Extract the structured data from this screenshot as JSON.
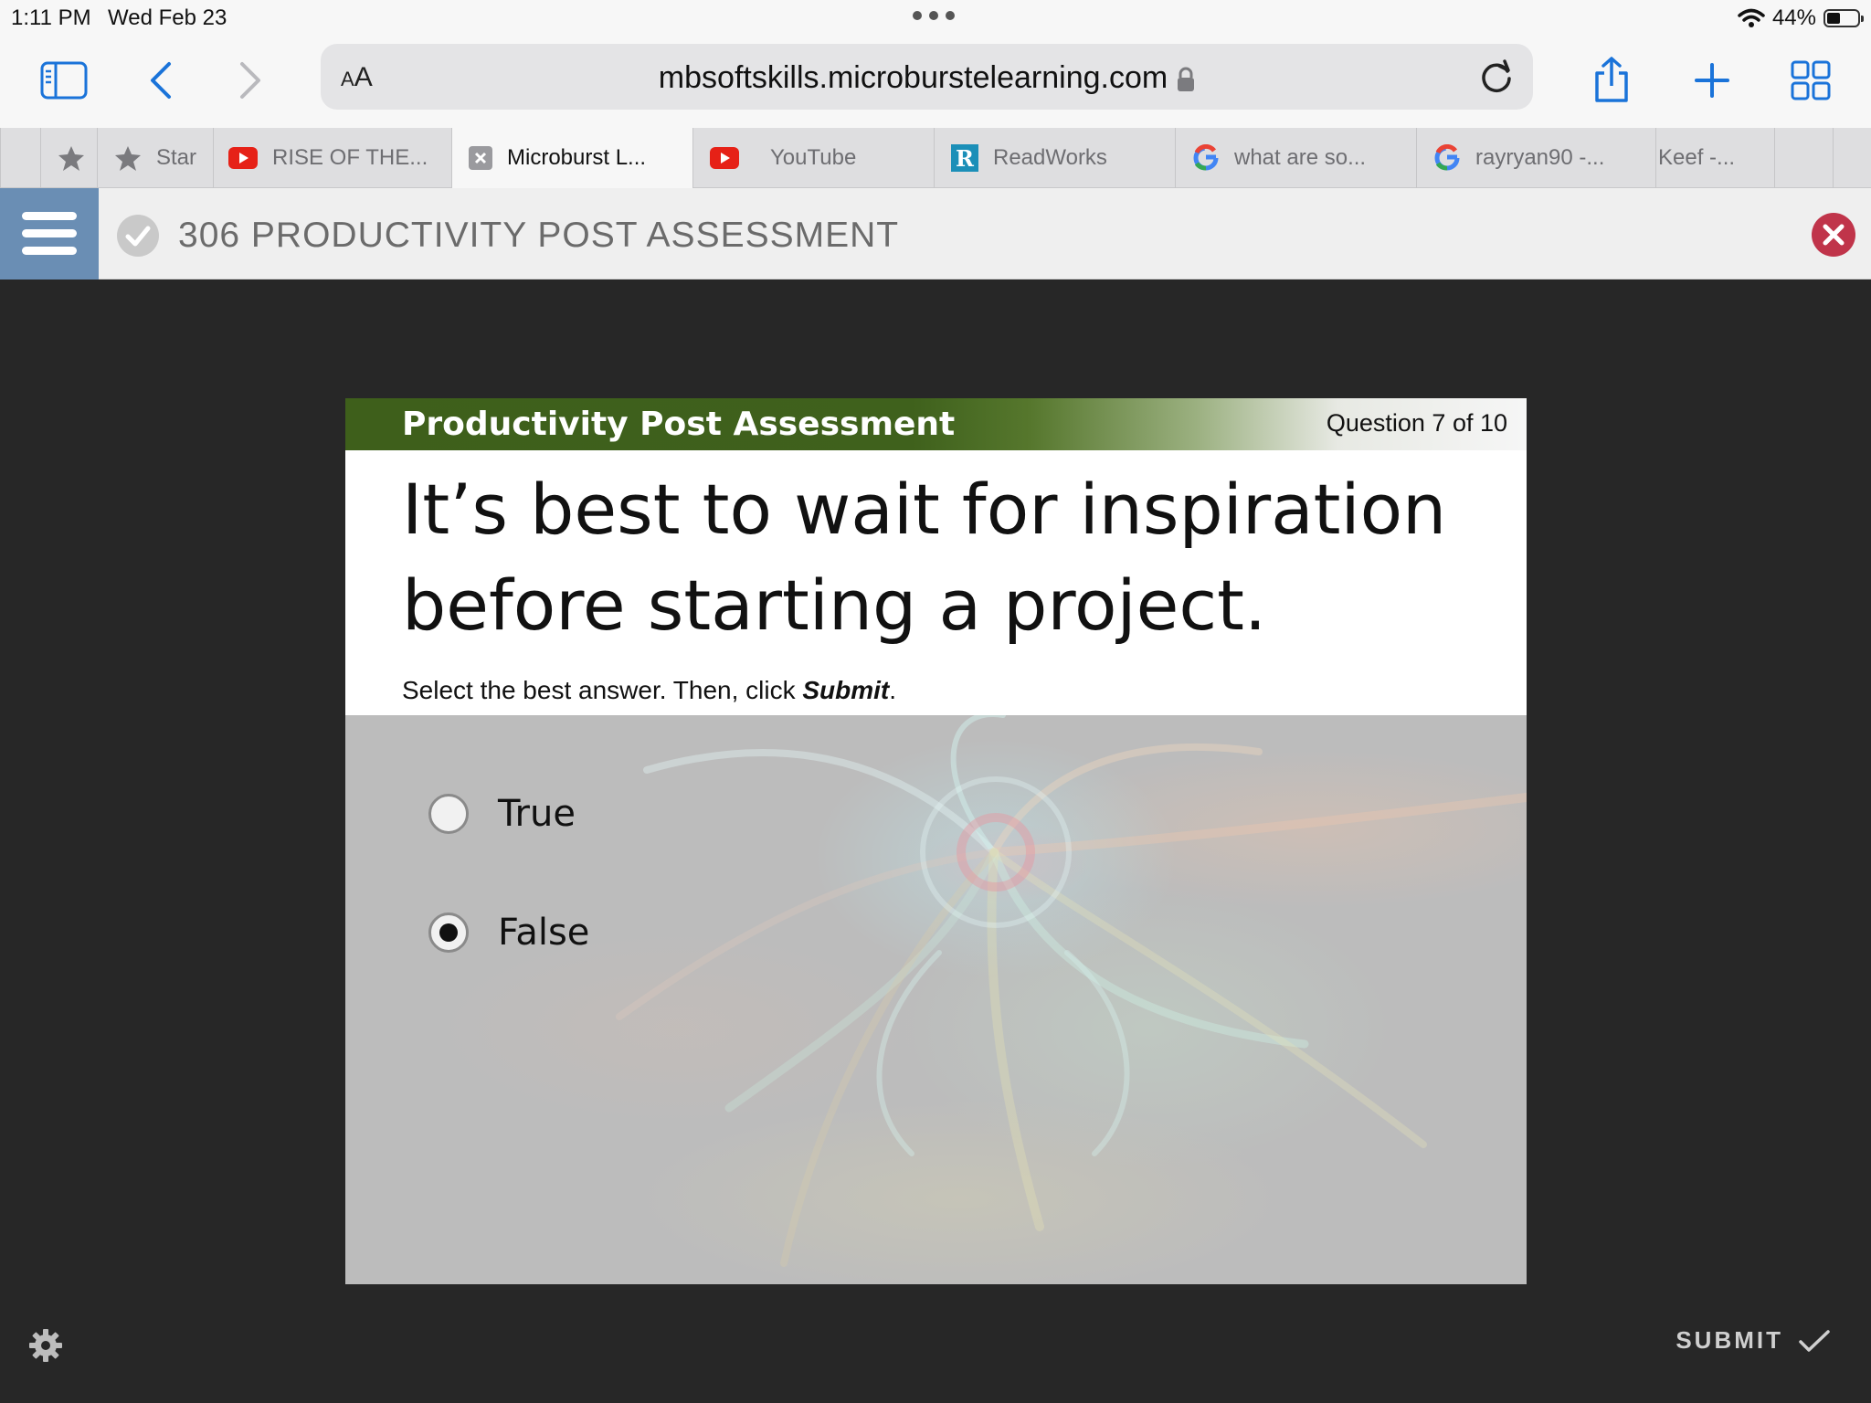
{
  "status_bar": {
    "time": "1:11 PM",
    "date": "Wed Feb 23",
    "battery": "44%",
    "battery_level": 0.44
  },
  "browser": {
    "aa_label": "AA",
    "url": "mbsoftskills.microburstelearning.com",
    "icons": [
      "sidebar-icon",
      "back-icon",
      "forward-icon",
      "lock-icon",
      "reload-icon",
      "share-icon",
      "new-tab-icon",
      "tab-overview-icon"
    ]
  },
  "tabs": [
    {
      "label": "Star",
      "favicon": "star-icon"
    },
    {
      "label": "RISE OF THE...",
      "favicon": "youtube-icon"
    },
    {
      "label": "Microburst L...",
      "favicon": "close-icon",
      "active": true
    },
    {
      "label": "YouTube",
      "favicon": "youtube-icon"
    },
    {
      "label": "ReadWorks",
      "favicon": "readworks-icon"
    },
    {
      "label": "what are so...",
      "favicon": "google-icon"
    },
    {
      "label": "rayryan90 -...",
      "favicon": "google-icon"
    },
    {
      "label": "Keef -...",
      "favicon": ""
    }
  ],
  "course": {
    "title": "306 PRODUCTIVITY POST ASSESSMENT"
  },
  "slide": {
    "banner_title": "Productivity Post Assessment",
    "counter": "Question 7 of 10",
    "question": "It’s best to wait for inspiration before starting a project.",
    "instruction_prefix": "Select the best answer. Then, click ",
    "instruction_emphasis": "Submit",
    "instruction_suffix": ".",
    "options": [
      {
        "label": "True",
        "selected": false
      },
      {
        "label": "False",
        "selected": true
      }
    ]
  },
  "player": {
    "submit_label": "SUBMIT"
  },
  "colors": {
    "accent_blue": "#1a73d9",
    "menu_blue": "#6a8eb4",
    "banner_green": "#3f611c",
    "close_red": "#c0344a"
  }
}
